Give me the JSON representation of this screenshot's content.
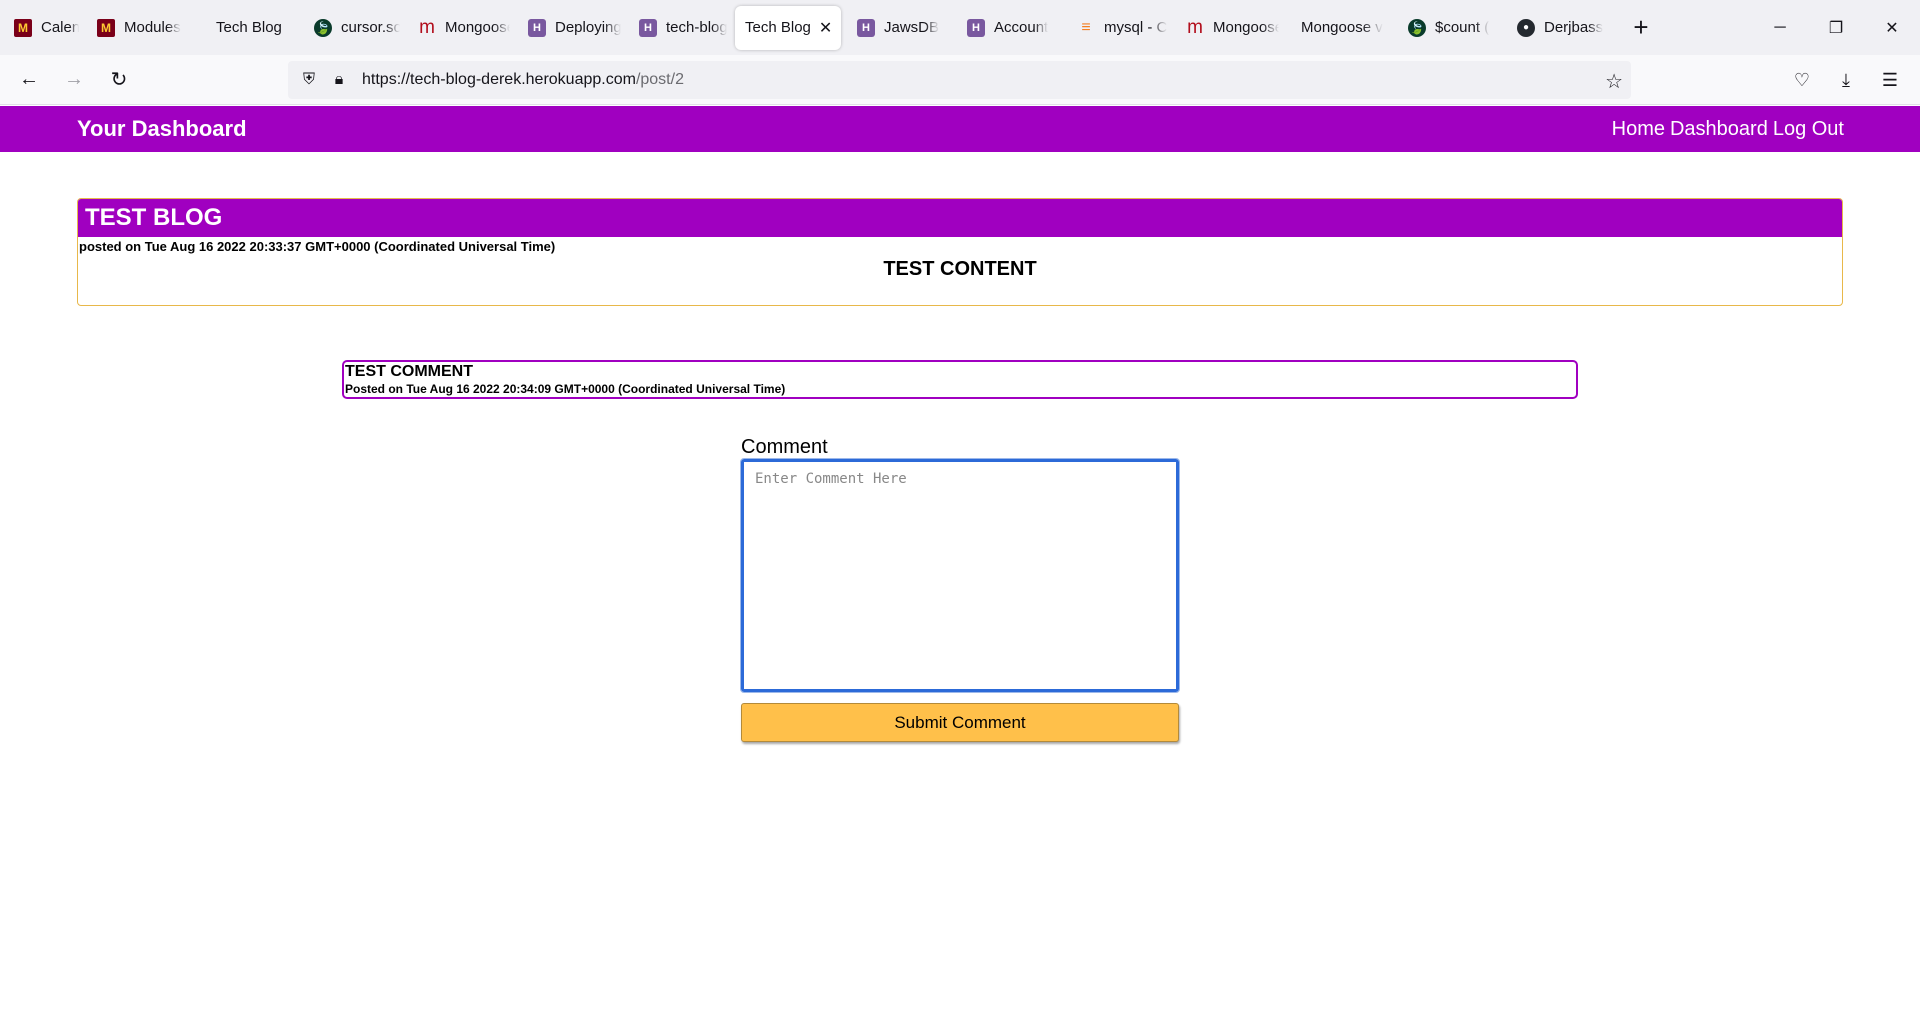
{
  "browser": {
    "tabs": [
      {
        "label": "Calendar",
        "icon": "umn-logo-icon"
      },
      {
        "label": "Modules",
        "icon": "umn-logo-icon"
      },
      {
        "label": "Tech Blog",
        "icon": ""
      },
      {
        "label": "cursor.sort",
        "icon": "mongodb-leaf-icon"
      },
      {
        "label": "Mongoose",
        "icon": "mdn-logo-icon"
      },
      {
        "label": "Deploying",
        "icon": "heroku-logo-icon"
      },
      {
        "label": "tech-blog",
        "icon": "heroku-logo-icon"
      },
      {
        "label": "Tech Blog",
        "icon": "",
        "active": true
      },
      {
        "label": "JawsDB",
        "icon": "heroku-logo-icon"
      },
      {
        "label": "Account",
        "icon": "heroku-logo-icon"
      },
      {
        "label": "mysql - C",
        "icon": "stackoverflow-logo-icon"
      },
      {
        "label": "Mongoose",
        "icon": "mdn-logo-icon"
      },
      {
        "label": "Mongoose v",
        "icon": ""
      },
      {
        "label": "$count (",
        "icon": "mongodb-leaf-icon"
      },
      {
        "label": "Derjbass",
        "icon": "github-logo-icon"
      }
    ],
    "url_host": "https://tech-blog-derek.herokuapp.com",
    "url_path": "/post/2"
  },
  "header": {
    "title": "Your Dashboard",
    "nav": [
      "Home",
      "Dashboard",
      "Log Out"
    ]
  },
  "post": {
    "title": "TEST BLOG",
    "date": "posted on Tue Aug 16 2022 20:33:37 GMT+0000 (Coordinated Universal Time)",
    "content": "TEST CONTENT"
  },
  "comments": [
    {
      "title": "TEST COMMENT",
      "date": "Posted on Tue Aug 16 2022 20:34:09 GMT+0000 (Coordinated Universal Time)"
    }
  ],
  "form": {
    "label": "Comment",
    "placeholder": "Enter Comment Here",
    "value": "",
    "submit_label": "Submit Comment"
  },
  "colors": {
    "brand_purple": "#a000c0",
    "post_border": "#e8b84a",
    "submit_bg": "#ffc04a",
    "focus_blue": "#2c6ad8"
  }
}
